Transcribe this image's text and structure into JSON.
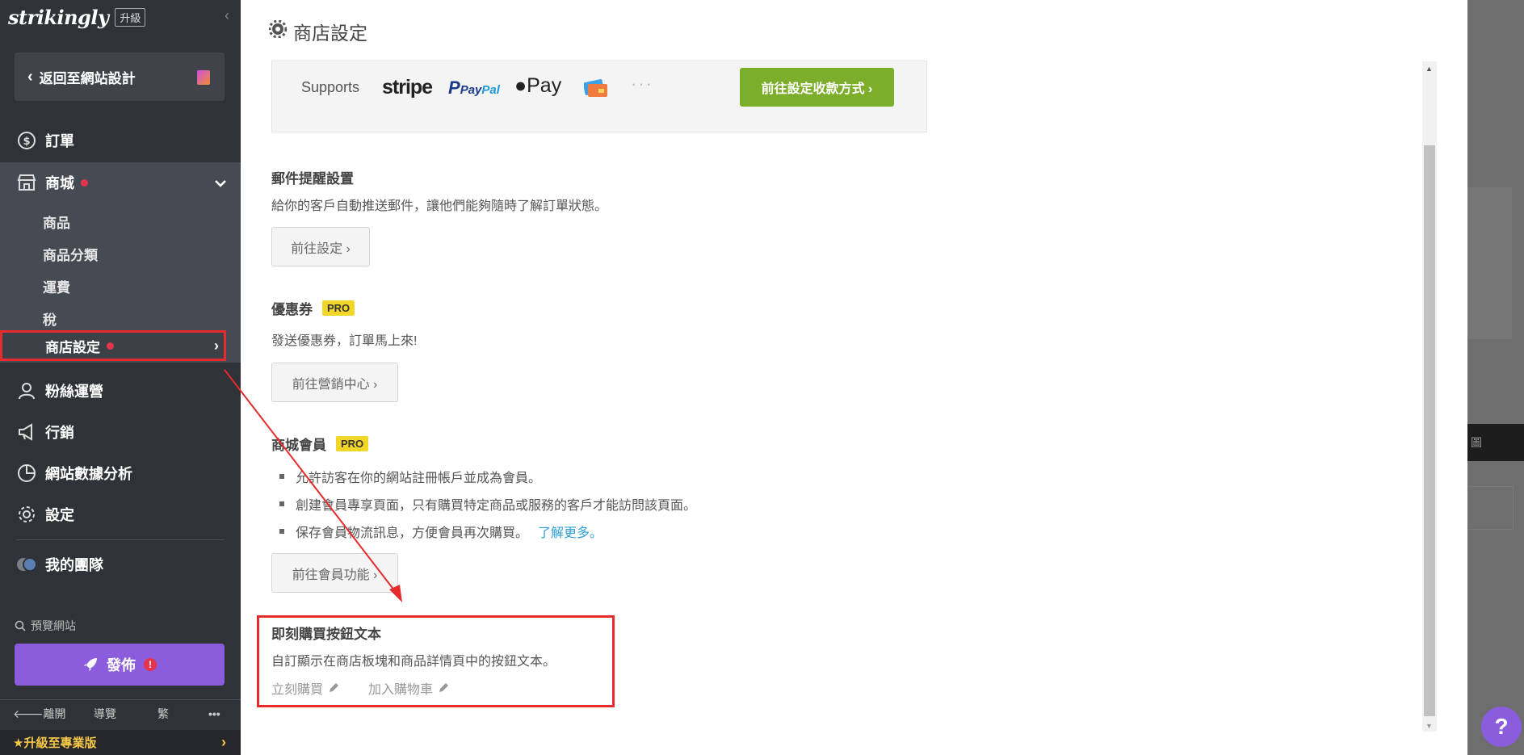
{
  "brand": {
    "logo": "strikingly",
    "upgrade": "升級"
  },
  "sidebar": {
    "back_label": "返回至網站設計",
    "orders": "訂單",
    "shop": "商城",
    "shop_sub": [
      "商品",
      "商品分類",
      "運費",
      "稅",
      "商店設定"
    ],
    "fans": "粉絲運營",
    "marketing": "行銷",
    "analytics": "網站數據分析",
    "settings": "設定",
    "team": "我的團隊",
    "preview": "預覽網站",
    "publish": "發佈",
    "publish_warn": "!",
    "footer": {
      "leave": "離開",
      "guide": "導覽",
      "lang": "繁",
      "more": "•••"
    },
    "upgrade_pro": "升級至專業版"
  },
  "main": {
    "title": "商店設定",
    "payment": {
      "supports": "Supports",
      "stripe": "stripe",
      "paypal_a": "Pay",
      "paypal_b": "Pal",
      "apple": "Pay",
      "dots": "···",
      "button": "前往設定收款方式 ›"
    },
    "email": {
      "title": "郵件提醒設置",
      "desc": "給你的客戶自動推送郵件，讓他們能夠隨時了解訂單狀態。",
      "button": "前往設定 ›"
    },
    "coupon": {
      "title": "優惠券",
      "badge": "PRO",
      "desc": "發送優惠券，訂單馬上來!",
      "button": "前往營銷中心 ›"
    },
    "membership": {
      "title": "商城會員",
      "badge": "PRO",
      "bullets": [
        "允許訪客在你的網站註冊帳戶並成為會員。",
        "創建會員專享頁面，只有購買特定商品或服務的客戶才能訪問該頁面。",
        "保存會員物流訊息，方便會員再次購買。"
      ],
      "learn_more": "了解更多。",
      "button": "前往會員功能 ›"
    },
    "buy_now": {
      "title": "即刻購買按鈕文本",
      "desc": "自訂顯示在商店板塊和商品詳情頁中的按鈕文本。",
      "buy_label": "立刻購買",
      "cart_label": "加入購物車"
    }
  },
  "backdrop": {
    "partial_text": "圖",
    "help": "?"
  },
  "colors": {
    "accent_green": "#7cad2b",
    "publish_purple": "#8b5cdc",
    "annotation_red": "#e52b2b",
    "pro_yellow": "#f2d629",
    "link_blue": "#2e9fd6"
  }
}
